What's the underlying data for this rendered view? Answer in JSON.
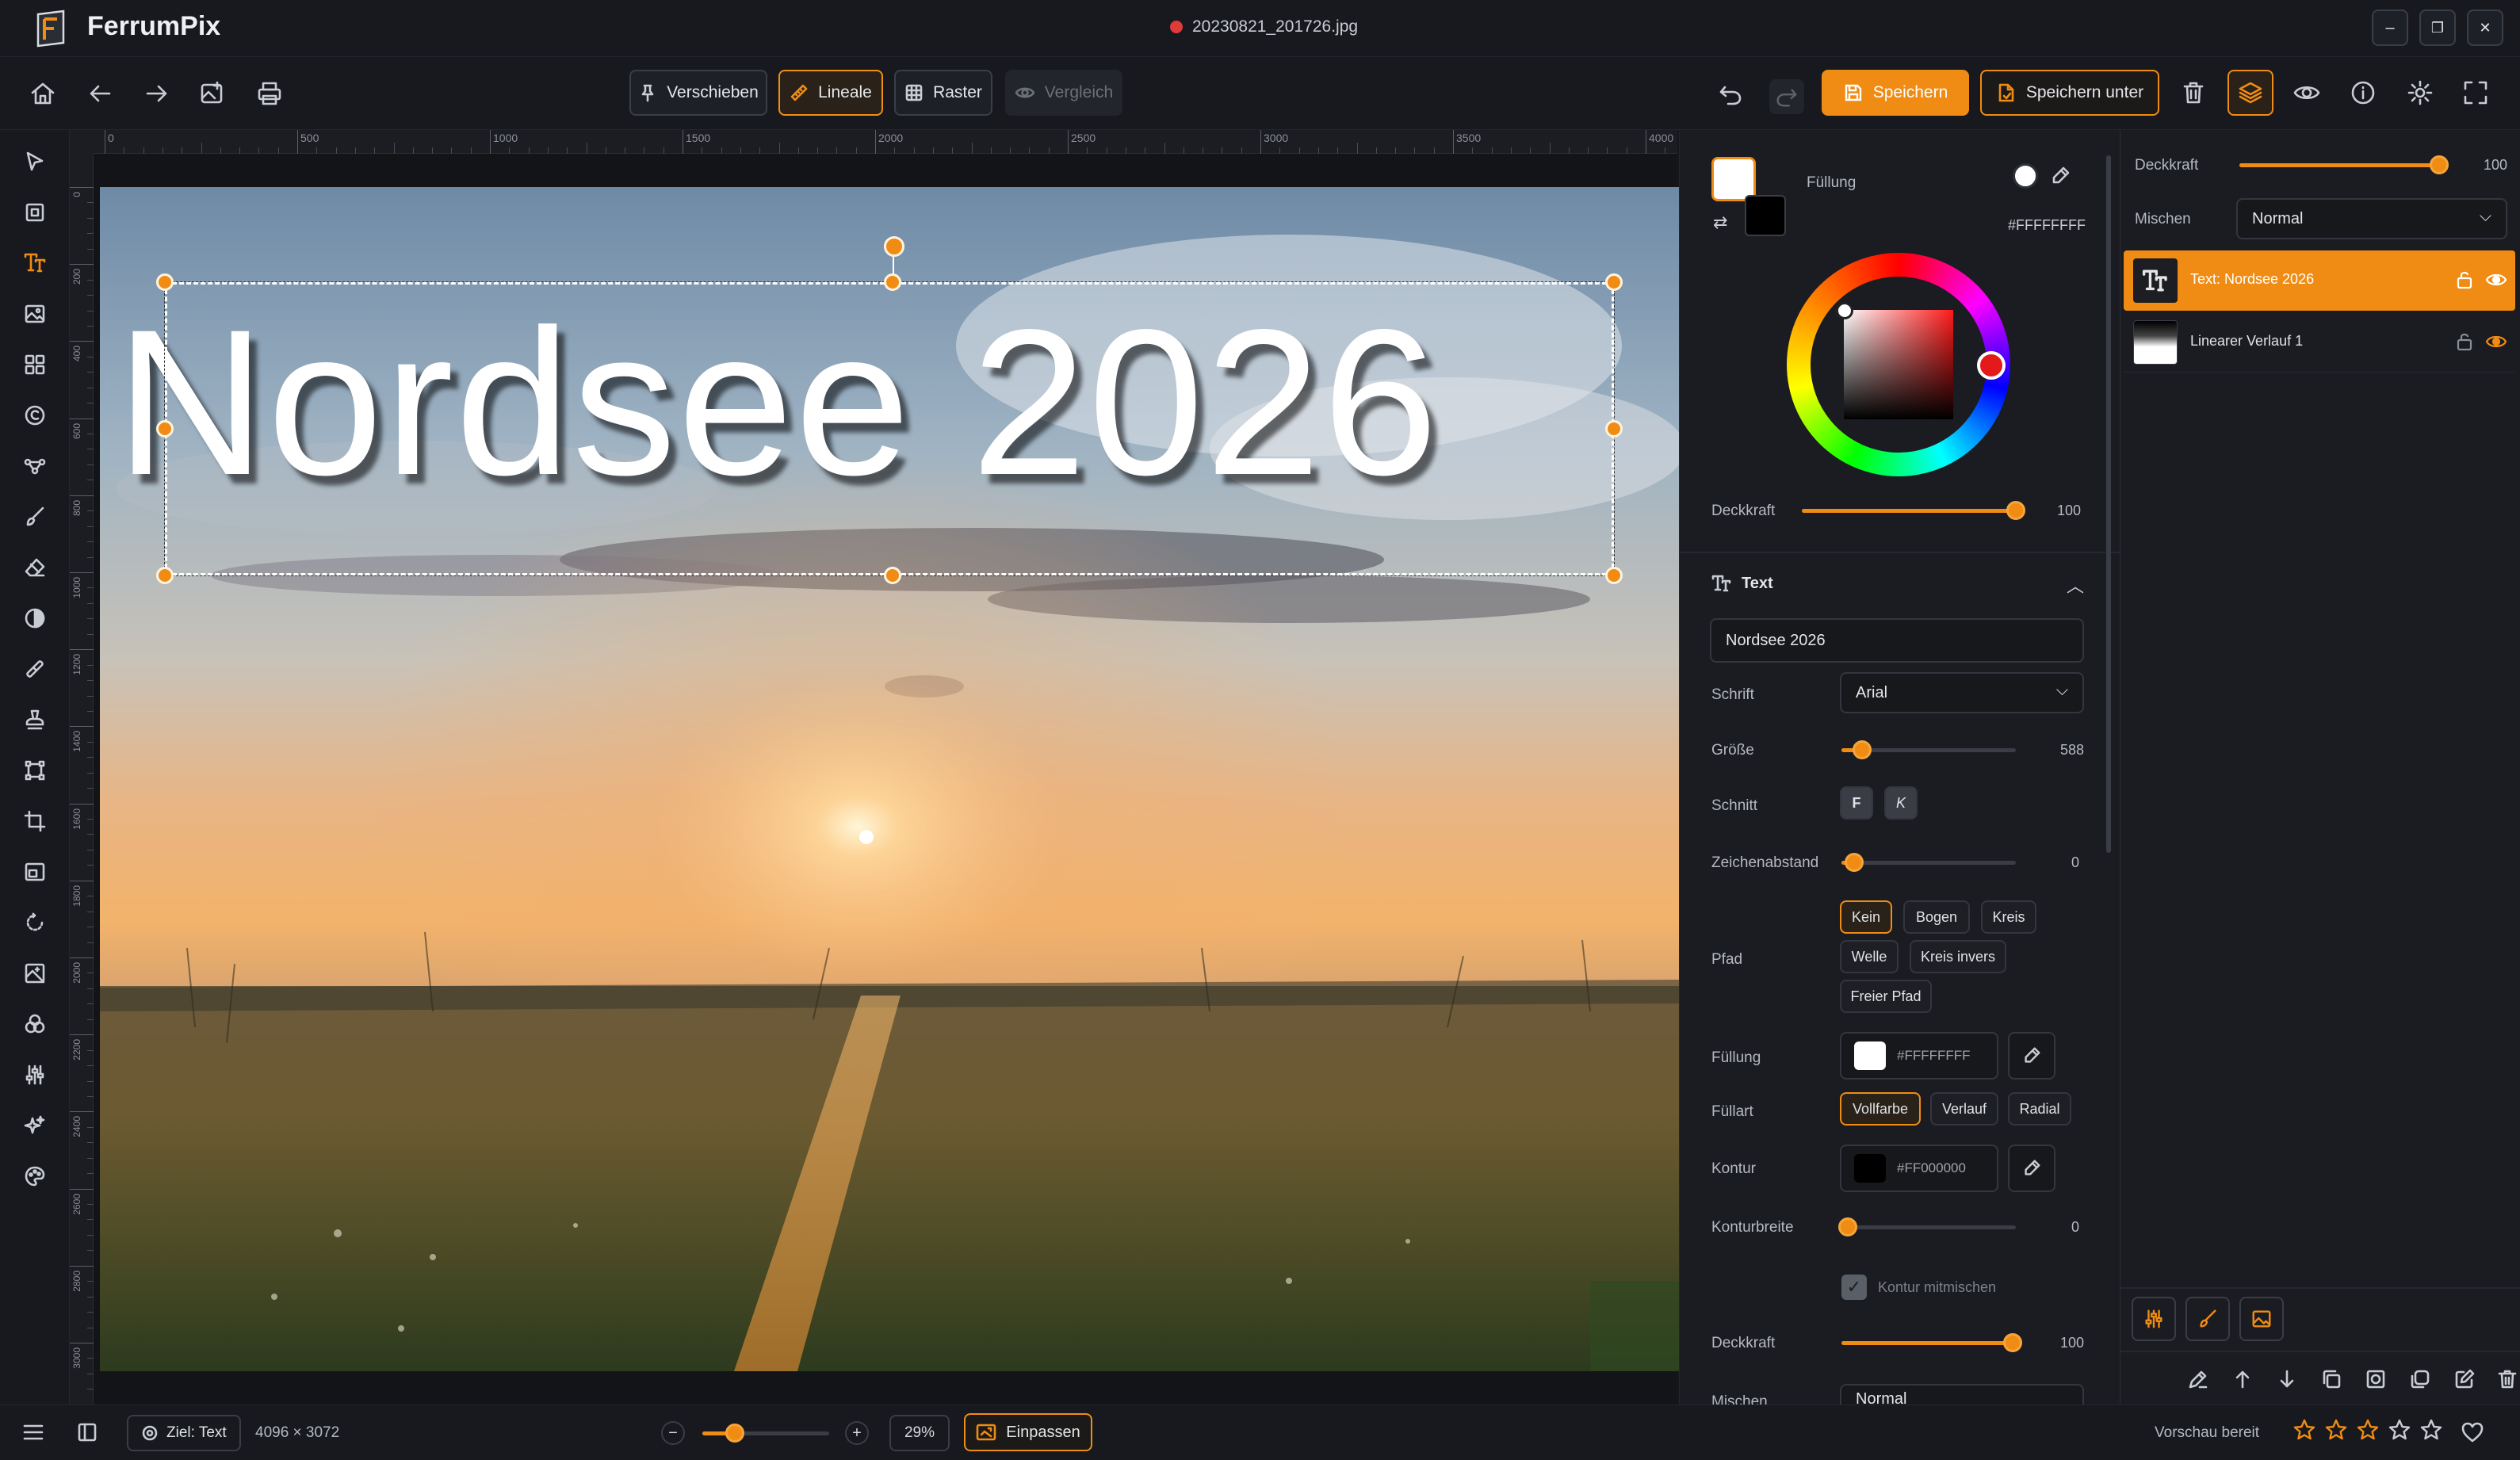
{
  "app": {
    "name": "FerrumPix",
    "filename": "20230821_201726.jpg",
    "unsaved_dot_color": "#e03a3a"
  },
  "window": {
    "minimize": "–",
    "restore": "❐",
    "close": "✕"
  },
  "toolbar": {
    "modes": [
      {
        "label": "Verschieben",
        "icon": "pin-icon",
        "active": false
      },
      {
        "label": "Lineale",
        "icon": "ruler-icon",
        "active": true
      },
      {
        "label": "Raster",
        "icon": "grid-icon",
        "active": false
      },
      {
        "label": "Vergleich",
        "icon": "eye-icon",
        "active": false,
        "disabled": true
      }
    ],
    "save_label": "Speichern",
    "save_as_label": "Speichern unter"
  },
  "ruler": {
    "h_ticks": [
      "0",
      "500",
      "1000",
      "1500",
      "2000",
      "2500",
      "3000",
      "3500",
      "4000"
    ],
    "v_ticks": [
      "0",
      "200",
      "400",
      "600",
      "800",
      "1000",
      "1200",
      "1400",
      "1600",
      "1800",
      "2000",
      "2200",
      "2400",
      "2600",
      "2800",
      "3000"
    ]
  },
  "canvas": {
    "text": "Nordsee 2026"
  },
  "color": {
    "fill_label": "Füllung",
    "hex": "#FFFFFFFF",
    "opacity_label": "Deckkraft",
    "opacity": 100,
    "primary": "#ffffff",
    "secondary": "#000000"
  },
  "text_panel": {
    "title": "Text",
    "content": "Nordsee 2026",
    "font_label": "Schrift",
    "font_value": "Arial",
    "size_label": "Größe",
    "size_value": 588,
    "style_label": "Schnitt",
    "style_bold": "F",
    "style_italic": "K",
    "spacing_label": "Zeichenabstand",
    "spacing_value": 0,
    "path_label": "Pfad",
    "path_options": [
      {
        "label": "Kein",
        "selected": true
      },
      {
        "label": "Bogen",
        "selected": false
      },
      {
        "label": "Kreis",
        "selected": false
      },
      {
        "label": "Welle",
        "selected": false
      },
      {
        "label": "Kreis invers",
        "selected": false
      },
      {
        "label": "Freier Pfad",
        "selected": false
      }
    ],
    "fill_label": "Füllung",
    "fill_hex": "#FFFFFFFF",
    "fill_type_label": "Füllart",
    "fill_types": [
      {
        "label": "Vollfarbe",
        "selected": true
      },
      {
        "label": "Verlauf",
        "selected": false
      },
      {
        "label": "Radial",
        "selected": false
      }
    ],
    "stroke_label": "Kontur",
    "stroke_hex": "#FF000000",
    "stroke_width_label": "Konturbreite",
    "stroke_width_value": 0,
    "stroke_blend_label": "Kontur mitmischen",
    "opacity_label": "Deckkraft",
    "opacity_value": 100,
    "blend_label": "Mischen",
    "blend_value": "Normal"
  },
  "layers": {
    "opacity_label": "Deckkraft",
    "opacity_value": 100,
    "blend_label": "Mischen",
    "blend_value": "Normal",
    "items": [
      {
        "name": "Text: Nordsee 2026",
        "selected": true
      },
      {
        "name": "Linearer Verlauf 1",
        "selected": false
      }
    ]
  },
  "status": {
    "target": "Ziel: Text",
    "dimensions": "4096 × 3072",
    "zoom": "29%",
    "zoom_level": 0.29,
    "fit_label": "Einpassen",
    "preview": "Vorschau bereit",
    "rating": 3
  },
  "colors": {
    "accent": "#f08c14",
    "bg": "#15171c",
    "panel": "#1a1c21"
  }
}
